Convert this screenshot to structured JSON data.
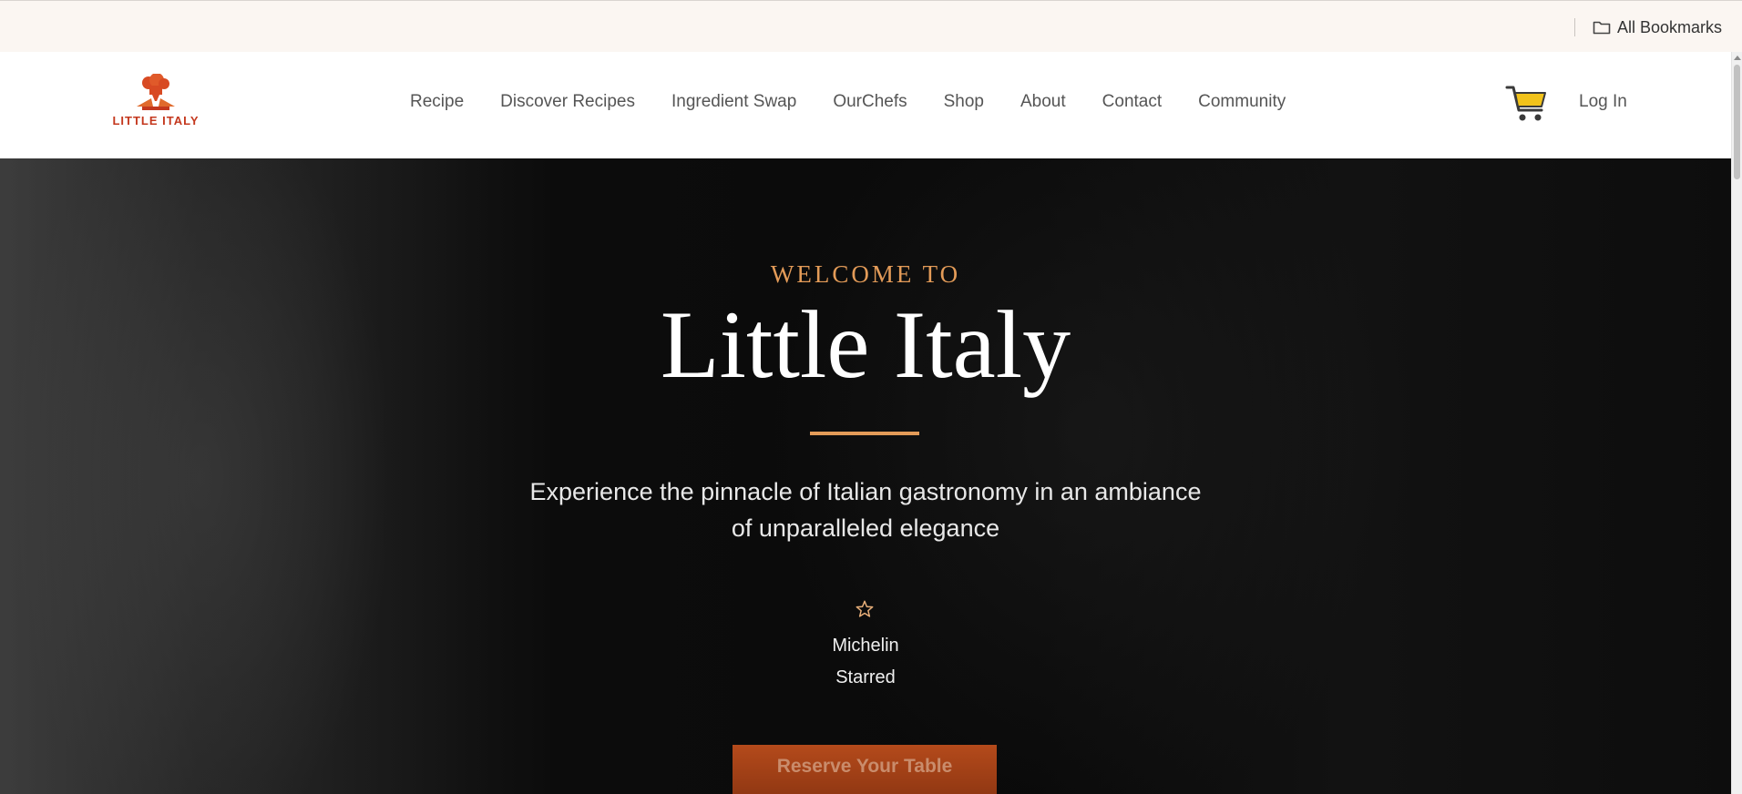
{
  "browser": {
    "bookmarks_bar": {
      "all_bookmarks_label": "All Bookmarks",
      "folder_icon": "folder-icon"
    }
  },
  "header": {
    "logo_text": "LITTLE ITALY",
    "logo_icon": "chef-hat-icon",
    "nav": [
      {
        "label": "Recipe"
      },
      {
        "label": "Discover Recipes"
      },
      {
        "label": "Ingredient Swap"
      },
      {
        "label": "OurChefs"
      },
      {
        "label": "Shop"
      },
      {
        "label": "About"
      },
      {
        "label": "Contact"
      },
      {
        "label": "Community"
      }
    ],
    "cart_icon": "shopping-cart-icon",
    "login_label": "Log In"
  },
  "hero": {
    "eyebrow": "WELCOME TO",
    "title": "Little Italy",
    "tagline_line1": "Experience the pinnacle of Italian gastronomy in an ambiance",
    "tagline_line2": "of unparalleled elegance",
    "award_icon": "star-icon",
    "award_line1": "Michelin",
    "award_line2": "Starred",
    "cta_label": "Reserve Your Table"
  },
  "colors": {
    "accent": "#e39b58",
    "brand": "#c4381e",
    "cta": "#a2421a",
    "cart": "#f2c31b"
  }
}
